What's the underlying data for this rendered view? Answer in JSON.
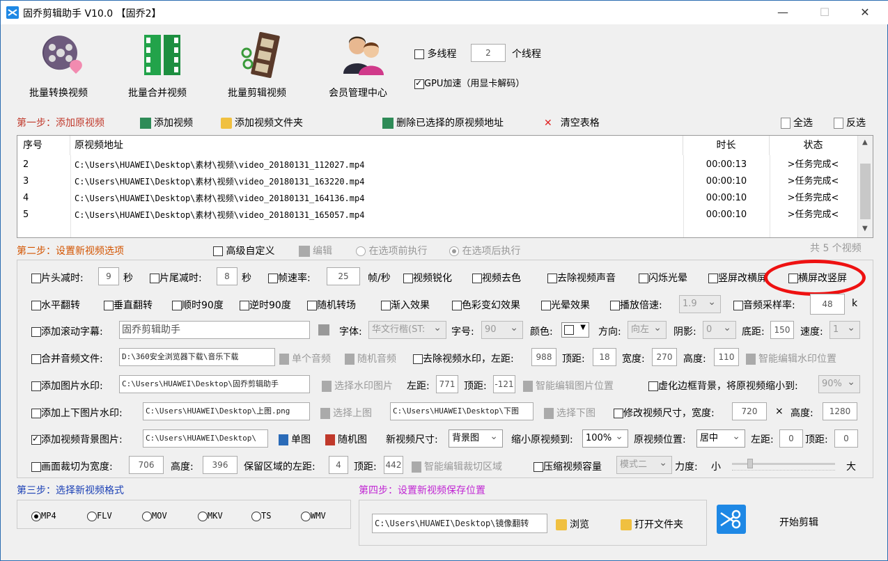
{
  "window": {
    "title": "固乔剪辑助手 V10.0 【固乔2】",
    "min": "—",
    "max": "☐",
    "close": "✕"
  },
  "toolbar": {
    "batch_convert": "批量转换视频",
    "batch_merge": "批量合并视频",
    "batch_edit": "批量剪辑视频",
    "member": "会员管理中心",
    "multithread": "多线程",
    "threads": "2",
    "threads_unit": "个线程",
    "gpu": "GPU加速（用显卡解码）"
  },
  "step1": {
    "label": "第一步：添加原视频",
    "add_video": "添加视频",
    "add_folder": "添加视频文件夹",
    "delete_selected": "删除已选择的原视频地址",
    "clear": "清空表格",
    "select_all": "全选",
    "invert": "反选"
  },
  "table": {
    "headers": [
      "序号",
      "原视频地址",
      "时长",
      "状态"
    ],
    "rows": [
      {
        "index": "2",
        "path": "C:\\Users\\HUAWEI\\Desktop\\素材\\视频\\video_20180131_112027.mp4",
        "duration": "00:00:13",
        "status": ">任务完成<"
      },
      {
        "index": "3",
        "path": "C:\\Users\\HUAWEI\\Desktop\\素材\\视频\\video_20180131_163220.mp4",
        "duration": "00:00:10",
        "status": ">任务完成<"
      },
      {
        "index": "4",
        "path": "C:\\Users\\HUAWEI\\Desktop\\素材\\视频\\video_20180131_164136.mp4",
        "duration": "00:00:10",
        "status": ">任务完成<"
      },
      {
        "index": "5",
        "path": "C:\\Users\\HUAWEI\\Desktop\\素材\\视频\\video_20180131_165057.mp4",
        "duration": "00:00:10",
        "status": ">任务完成<"
      }
    ]
  },
  "step2": {
    "label": "第二步：设置新视频选项",
    "advanced": "高级自定义",
    "edit": "编辑",
    "before": "在选项前执行",
    "after": "在选项后执行",
    "count": "共 5 个视频"
  },
  "row1": {
    "head_cut": "片头减时:",
    "head_val": "9",
    "sec1": "秒",
    "tail_cut": "片尾减时:",
    "tail_val": "8",
    "sec2": "秒",
    "fps": "帧速率:",
    "fps_val": "25",
    "fps_unit": "帧/秒",
    "sharpen": "视频锐化",
    "decolor": "视频去色",
    "mute": "去除视频声音",
    "flash": "闪烁光晕",
    "v2h": "竖屏改横屏",
    "h2v": "横屏改竖屏"
  },
  "row2": {
    "hflip": "水平翻转",
    "vflip": "垂直翻转",
    "cw90": "顺时90度",
    "ccw90": "逆时90度",
    "random_trans": "随机转场",
    "fade": "渐入效果",
    "color": "色彩变幻效果",
    "glow": "光晕效果",
    "speed": "播放倍速:",
    "speed_val": "1.9",
    "samplerate": "音频采样率:",
    "samplerate_val": "48",
    "k": "k"
  },
  "row3": {
    "subtitle": "添加滚动字幕:",
    "subtitle_val": "固乔剪辑助手",
    "font": "字体:",
    "font_val": "华文行楷(ST:",
    "size": "字号:",
    "size_val": "90",
    "color": "颜色:",
    "dir": "方向:",
    "dir_val": "向左",
    "shadow": "阴影:",
    "shadow_val": "0",
    "bottom": "底距:",
    "bottom_val": "150",
    "speed": "速度:",
    "speed_val": "1"
  },
  "row4": {
    "audio": "合并音频文件:",
    "audio_val": "D:\\360安全浏览器下载\\音乐下载",
    "single": "单个音频",
    "random": "随机音频",
    "wm": "去除视频水印，左距:",
    "left_val": "988",
    "top": "顶距:",
    "top_val": "18",
    "width": "宽度:",
    "width_val": "270",
    "height": "高度:",
    "height_val": "110",
    "smart": "智能编辑水印位置"
  },
  "row5": {
    "img_wm": "添加图片水印:",
    "img_val": "C:\\Users\\HUAWEI\\Desktop\\固乔剪辑助手",
    "choose": "选择水印图片",
    "left": "左距:",
    "left_val": "771",
    "top": "顶距:",
    "top_val": "-121",
    "smart": "智能编辑图片位置",
    "blur": "虚化边框背景，将原视频缩小到:",
    "blur_val": "90%"
  },
  "row6": {
    "tb": "添加上下图片水印:",
    "top_img": "C:\\Users\\HUAWEI\\Desktop\\上图.png",
    "choose_top": "选择上图",
    "bottom_img": "C:\\Users\\HUAWEI\\Desktop\\下图",
    "choose_bottom": "选择下图",
    "resize": "修改视频尺寸，宽度:",
    "w_val": "720",
    "x": "×",
    "h": "高度:",
    "h_val": "1280"
  },
  "row7": {
    "bg": "添加视频背景图片:",
    "bg_val": "C:\\Users\\HUAWEI\\Desktop\\",
    "single": "单图",
    "random": "随机图",
    "newsize": "新视频尺寸:",
    "newsize_val": "背景图",
    "shrink": "缩小原视频到:",
    "shrink_val": "100%",
    "pos": "原视频位置:",
    "pos_val": "居中",
    "left": "左距:",
    "left_val": "0",
    "top": "顶距:",
    "top_val": "0"
  },
  "row8": {
    "crop": "画面裁切为宽度:",
    "w_val": "706",
    "h": "高度:",
    "h_val": "396",
    "keep_left": "保留区域的左距:",
    "left_val": "4",
    "top": "顶距:",
    "top_val": "442",
    "smart": "智能编辑裁切区域",
    "compress": "压缩视频容量",
    "mode": "模式二",
    "force": "力度:",
    "small": "小",
    "big": "大"
  },
  "step3": {
    "label": "第三步：选择新视频格式",
    "formats": [
      "MP4",
      "FLV",
      "MOV",
      "MKV",
      "TS",
      "WMV"
    ]
  },
  "step4": {
    "label": "第四步：设置新视频保存位置",
    "path": "C:\\Users\\HUAWEI\\Desktop\\镜像翻转",
    "browse": "浏览",
    "open": "打开文件夹",
    "start": "开始剪辑"
  },
  "colors": {
    "step_red": "#c0392b",
    "step_blue": "#1a3fb5",
    "step_purple": "#c026d3",
    "highlight": "#e11111"
  }
}
